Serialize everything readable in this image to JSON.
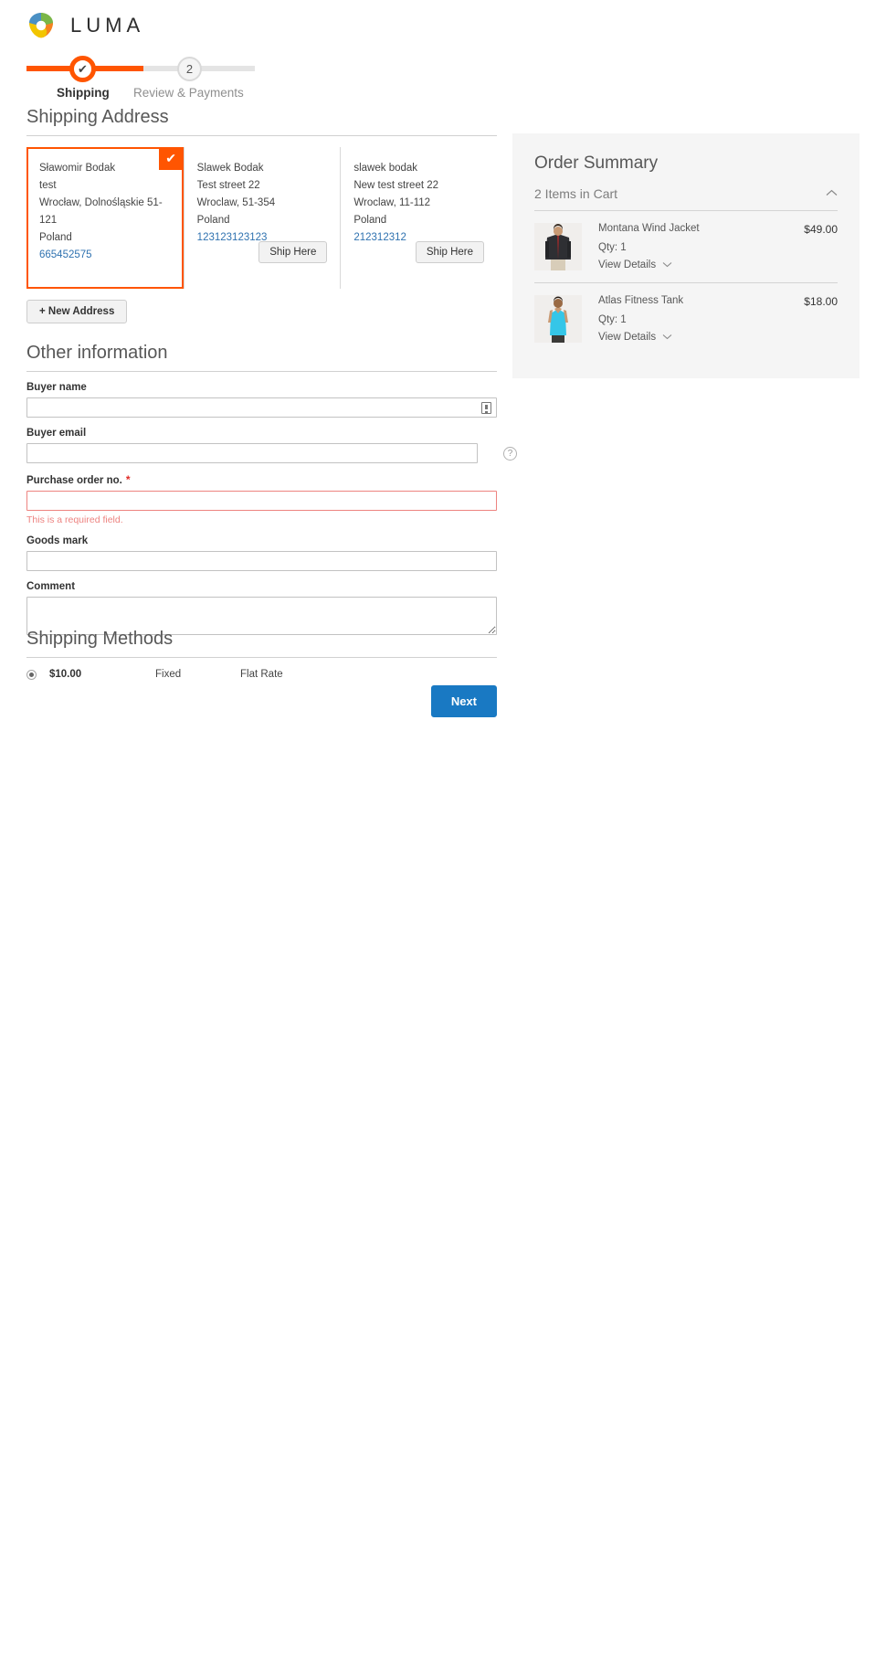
{
  "brand": {
    "name": "LUMA",
    "logo_icon": "luma-flower-logo"
  },
  "progress": {
    "steps": [
      {
        "label": "Shipping",
        "marker": "✔",
        "state": "active"
      },
      {
        "label": "Review & Payments",
        "marker": "2",
        "state": "inactive"
      }
    ],
    "accent_color": "#ff5501"
  },
  "shipping_address": {
    "heading": "Shipping Address",
    "new_address_label": "+ New Address",
    "selected_tick": "✔",
    "addresses": [
      {
        "name": "Sławomir Bodak",
        "street": "test",
        "city_region_zip": "Wrocław, Dolnośląskie 51-121",
        "country": "Poland",
        "phone": "665452575",
        "selected": true,
        "ship_here_label": ""
      },
      {
        "name": "Slawek Bodak",
        "street": "Test street 22",
        "city_region_zip": "Wroclaw, 51-354",
        "country": "Poland",
        "phone": "123123123123",
        "selected": false,
        "ship_here_label": "Ship Here"
      },
      {
        "name": "slawek bodak",
        "street": "New test street 22",
        "city_region_zip": "Wroclaw, 11-112",
        "country": "Poland",
        "phone": "212312312",
        "selected": false,
        "ship_here_label": "Ship Here"
      }
    ]
  },
  "other_information": {
    "heading": "Other information",
    "fields": [
      {
        "label": "Buyer name",
        "value": "",
        "placeholder": "",
        "icon": "calendar-icon",
        "required": false
      },
      {
        "label": "Buyer email",
        "value": "",
        "placeholder": "",
        "icon": "help-circle-icon",
        "required": false
      },
      {
        "label": "Purchase order no.",
        "value": "",
        "placeholder": "",
        "required": true,
        "required_marker": "*",
        "error": "This is a required field."
      },
      {
        "label": "Goods mark",
        "value": "",
        "placeholder": "",
        "required": false
      },
      {
        "label": "Comment",
        "value": "",
        "placeholder": "",
        "required": false,
        "multiline": true
      }
    ]
  },
  "shipping_methods": {
    "heading": "Shipping Methods",
    "rows": [
      {
        "price": "$10.00",
        "carrier": "Fixed",
        "method": "Flat Rate",
        "selected": true
      }
    ],
    "next_label": "Next",
    "next_color": "#1979c3"
  },
  "order_summary": {
    "title": "Order Summary",
    "items_in_cart": "2 Items in Cart",
    "collapse_icon": "chevron-up-icon",
    "items": [
      {
        "name": "Montana Wind Jacket",
        "price": "$49.00",
        "qty": "Qty: 1",
        "view_details": "View Details",
        "details_icon": "chevron-down-icon",
        "thumb": "montana-wind-jacket-thumb"
      },
      {
        "name": "Atlas Fitness Tank",
        "price": "$18.00",
        "qty": "Qty: 1",
        "view_details": "View Details",
        "details_icon": "chevron-down-icon",
        "thumb": "atlas-fitness-tank-thumb"
      }
    ]
  }
}
